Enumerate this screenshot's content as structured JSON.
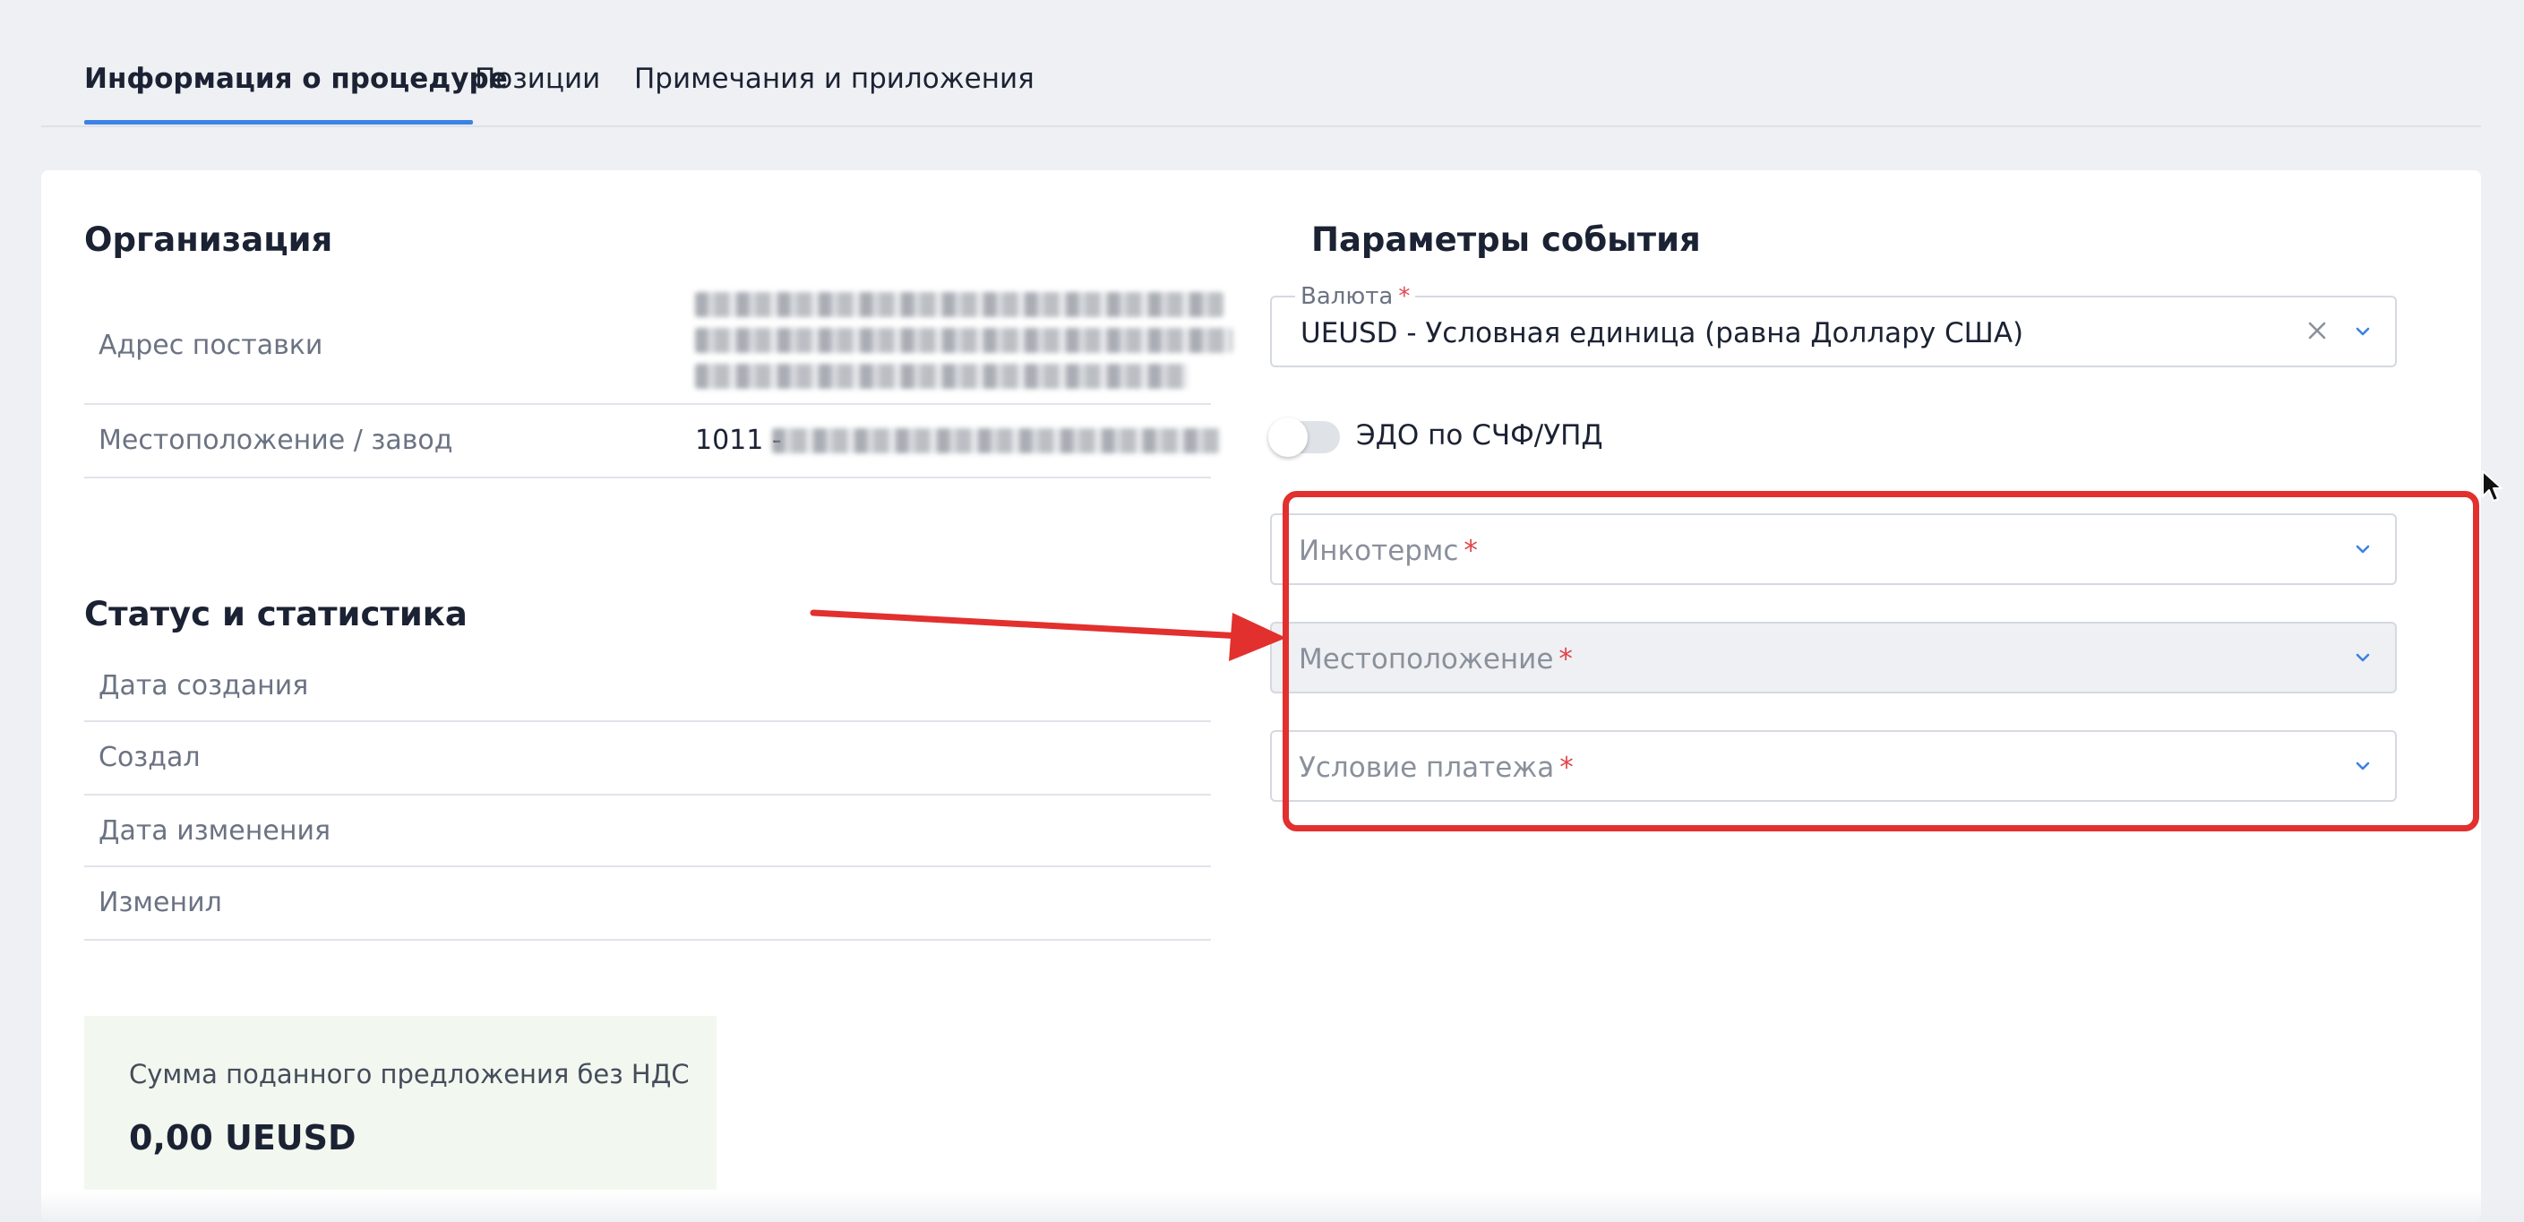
{
  "tabs": [
    {
      "label": "Информация о процедуре",
      "active": true
    },
    {
      "label": "Позиции",
      "active": false
    },
    {
      "label": "Примечания и приложения",
      "active": false
    }
  ],
  "organization": {
    "title": "Организация",
    "rows": [
      {
        "label": "Адрес поставки",
        "value": ""
      },
      {
        "label": "Местоположение / завод",
        "value": "1011 -"
      }
    ]
  },
  "status": {
    "title": "Статус и статистика",
    "rows": [
      {
        "label": "Дата создания",
        "value": ""
      },
      {
        "label": "Создал",
        "value": ""
      },
      {
        "label": "Дата изменения",
        "value": ""
      },
      {
        "label": "Изменил",
        "value": ""
      }
    ]
  },
  "summary": {
    "label": "Сумма поданного предложения без НДС",
    "value": "0,00 UEUSD"
  },
  "event_params": {
    "title": "Параметры события",
    "currency": {
      "label": "Валюта",
      "required_mark": "*",
      "value": "UEUSD - Условная единица (равна Доллару США)"
    },
    "edo_toggle": {
      "label": "ЭДО по СЧФ/УПД",
      "enabled": false
    },
    "incoterms": {
      "placeholder": "Инкотермс",
      "required_mark": "*"
    },
    "location": {
      "placeholder": "Местоположение",
      "required_mark": "*"
    },
    "payment_terms": {
      "placeholder": "Условие платежа",
      "required_mark": "*"
    }
  },
  "colors": {
    "accent": "#3b82e6",
    "required": "#e0464c",
    "annotation": "#e2302e",
    "summary_bg": "#f2f8f0"
  }
}
